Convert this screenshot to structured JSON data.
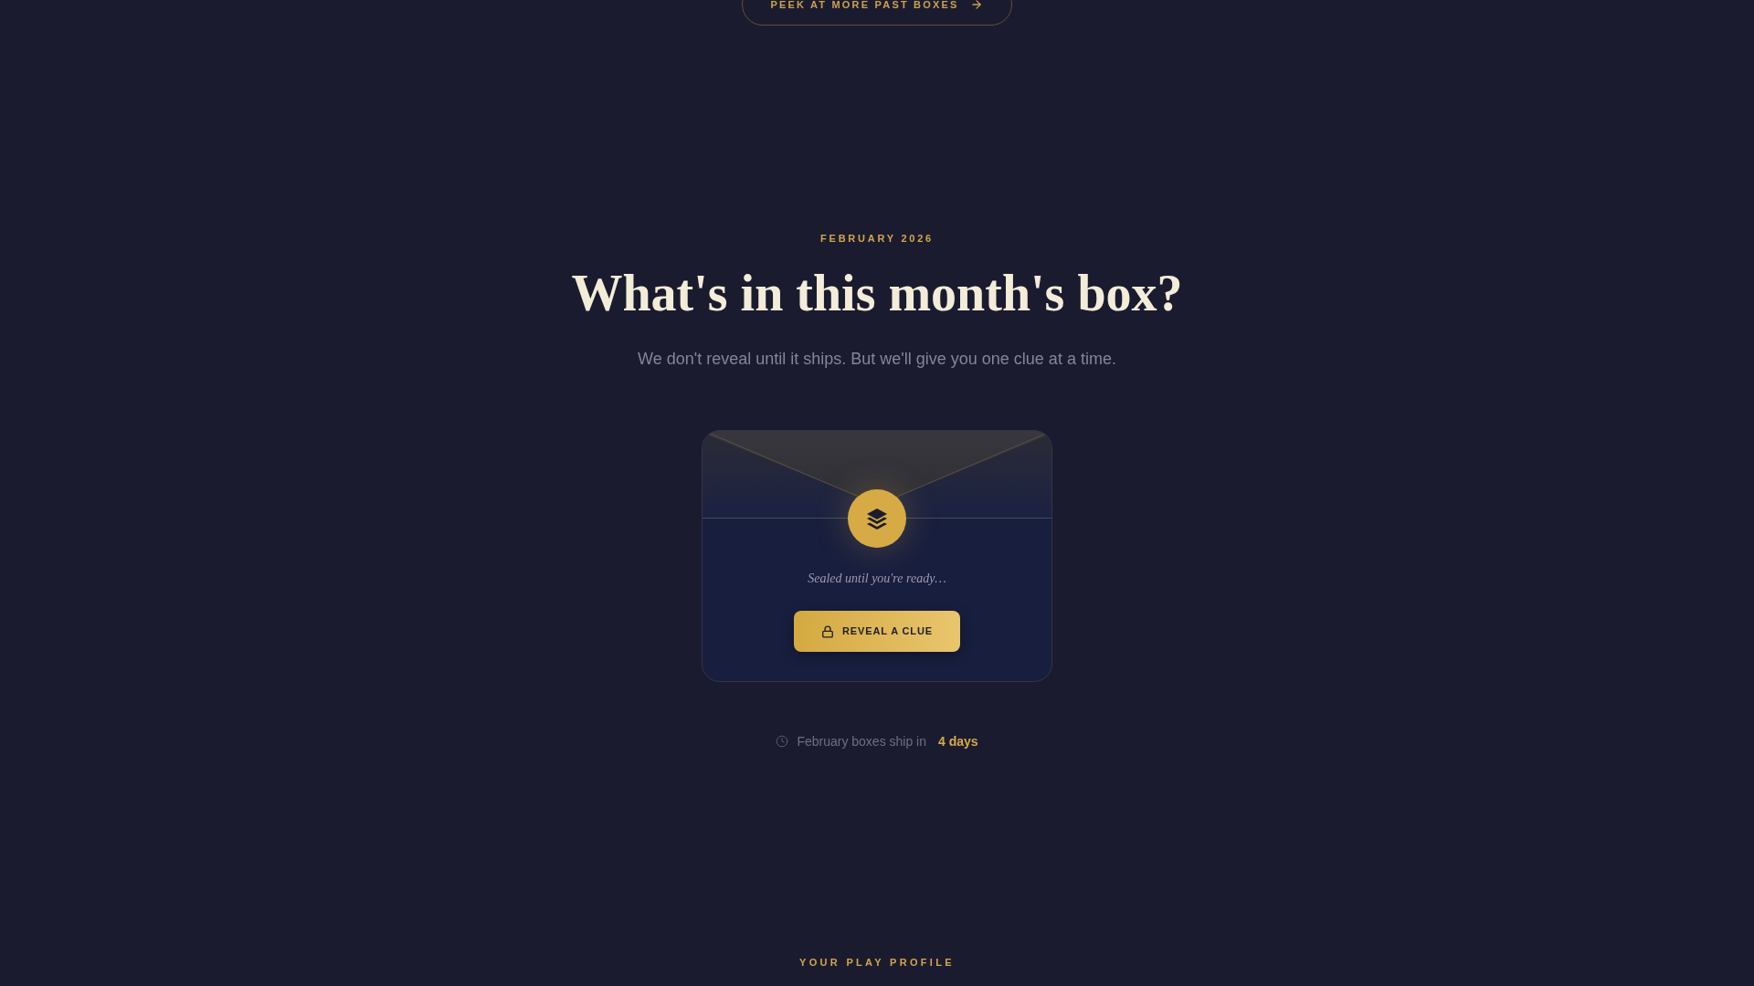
{
  "top_button": {
    "label": "PEEK AT MORE PAST BOXES"
  },
  "hero": {
    "eyebrow": "FEBRUARY 2026",
    "title": "What's in this month's box?",
    "subtitle": "We don't reveal until it ships. But we'll give you one clue at a time."
  },
  "envelope": {
    "caption": "Sealed until you're ready…",
    "button": {
      "label": "REVEAL A CLUE"
    }
  },
  "shipping": {
    "text": "February boxes ship in",
    "countdown": "4 days"
  },
  "next_section": {
    "eyebrow": "YOUR PLAY PROFILE"
  }
}
